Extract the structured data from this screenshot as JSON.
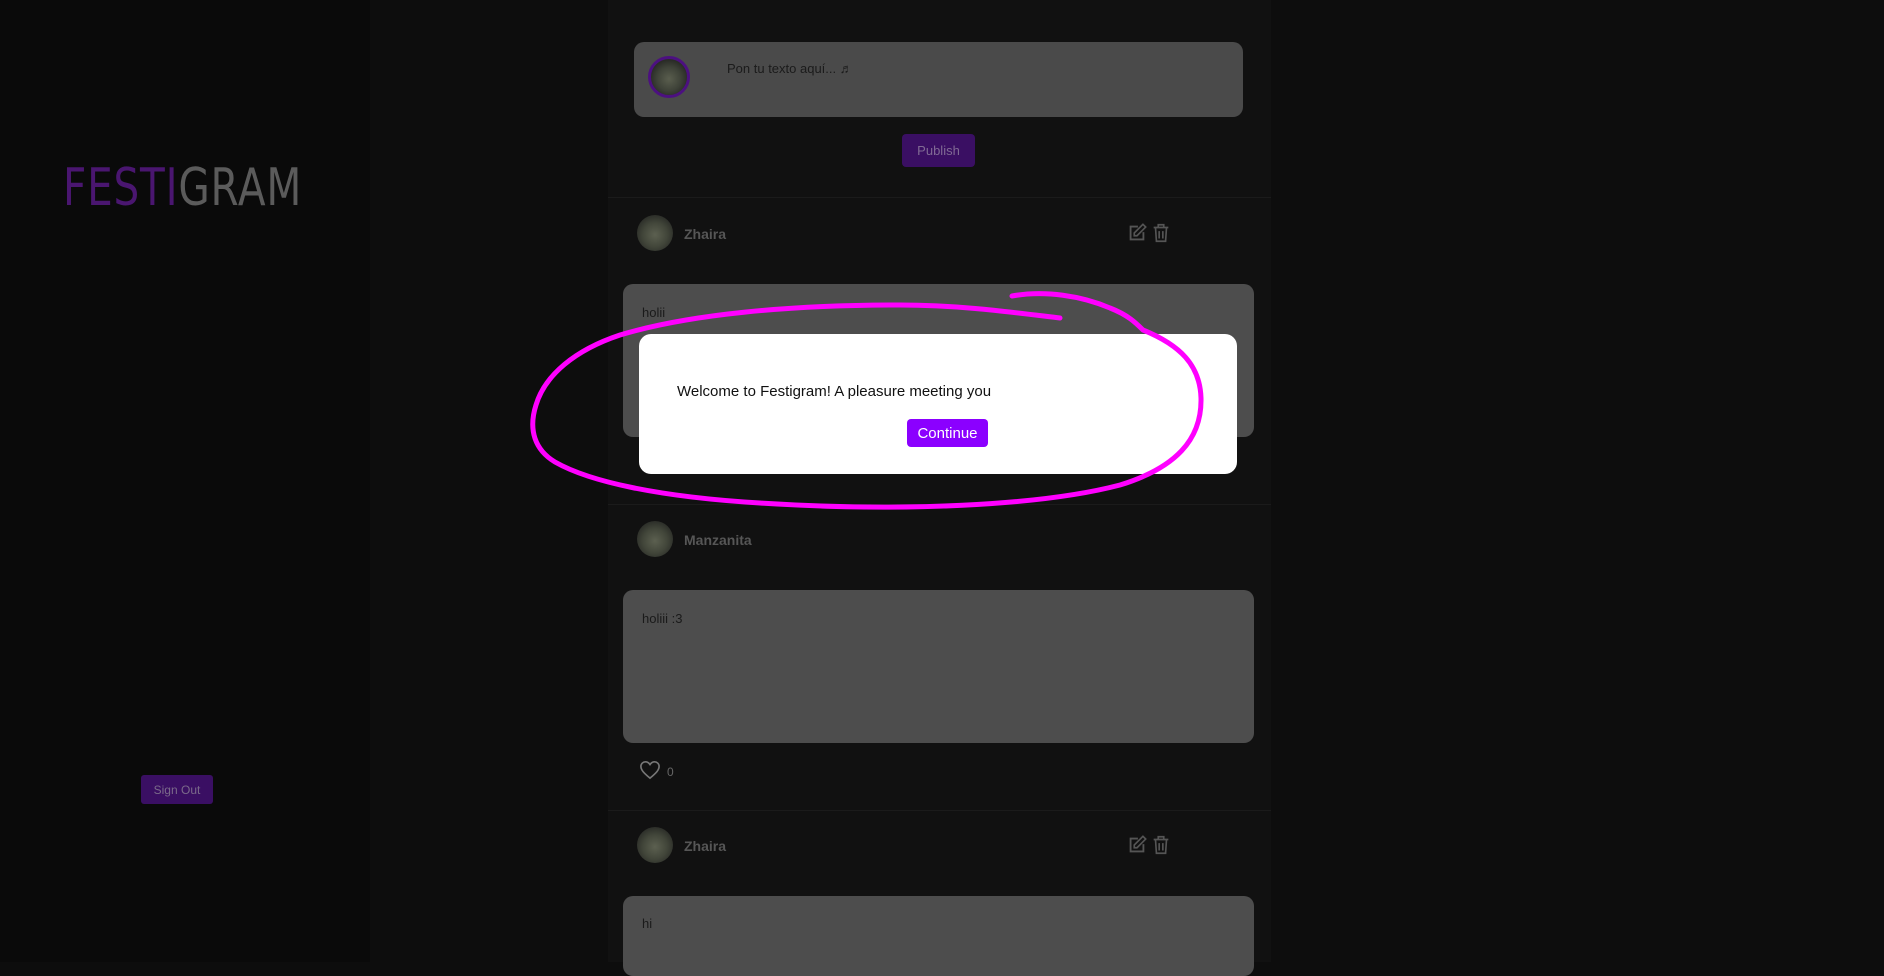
{
  "app": {
    "logo_part1": "FESTI",
    "logo_part2": "GRAM"
  },
  "sidebar": {
    "sign_out_label": "Sign Out"
  },
  "composer": {
    "placeholder": "Pon tu texto aquí... ♬",
    "publish_label": "Publish"
  },
  "posts": [
    {
      "author": "Zhaira",
      "text": "holii",
      "editable": true
    },
    {
      "author": "Manzanita",
      "text": "holiii :3",
      "likes": "0",
      "editable": false
    },
    {
      "author": "Zhaira",
      "text": "hi",
      "editable": true
    }
  ],
  "modal": {
    "message": "Welcome to Festigram! A pleasure meeting you",
    "continue_label": "Continue"
  },
  "colors": {
    "accent": "#8b00ff",
    "annotation": "#ff00ff",
    "logo_festi": "#4a1670",
    "logo_gram": "#5b5b5b"
  }
}
